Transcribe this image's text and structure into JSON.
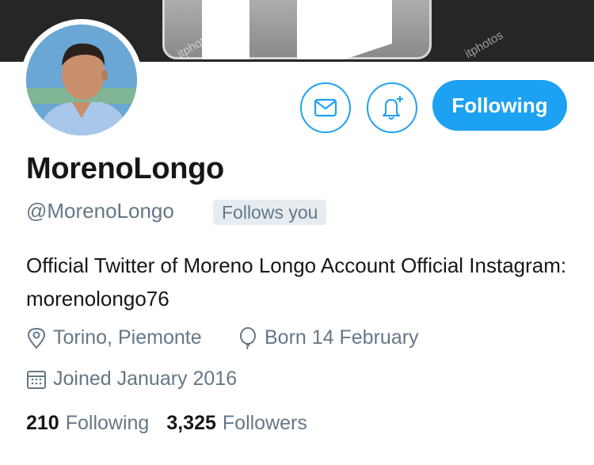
{
  "banner": {
    "watermark": "itphotos"
  },
  "actions": {
    "follow_label": "Following"
  },
  "profile": {
    "name": "MorenoLongo",
    "handle": "@MorenoLongo",
    "follows_you": "Follows you",
    "bio": "Official Twitter of Moreno Longo Account Official Instagram: morenolongo76",
    "location": "Torino, Piemonte",
    "birthday": "Born 14 February",
    "joined": "Joined January 2016"
  },
  "stats": {
    "following_count": "210",
    "following_label": "Following",
    "followers_count": "3,325",
    "followers_label": "Followers"
  },
  "colors": {
    "accent": "#1da1f2",
    "muted": "#657786",
    "text": "#14171a",
    "badge_bg": "#e6ecf0"
  },
  "icons": [
    "envelope-icon",
    "bell-plus-icon",
    "location-pin-icon",
    "balloon-icon",
    "calendar-icon"
  ]
}
